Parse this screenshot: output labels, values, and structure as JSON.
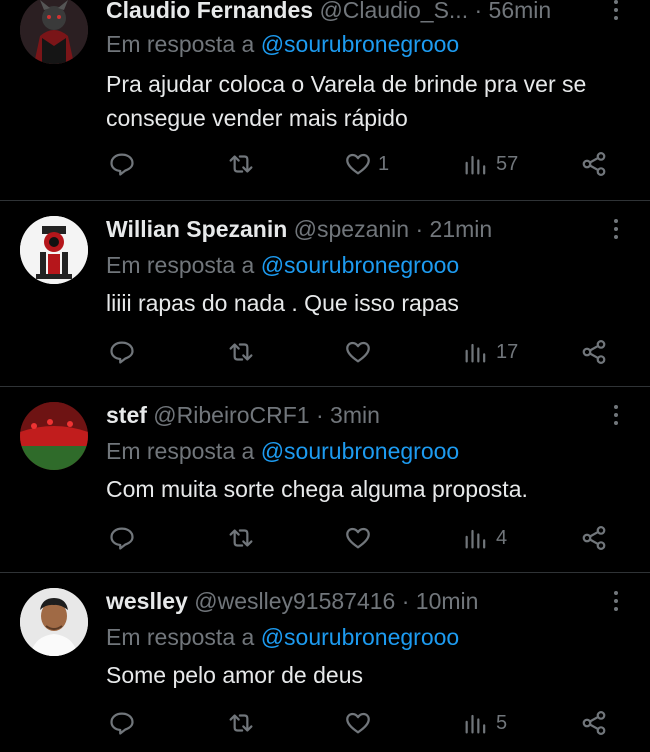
{
  "reply_prefix": "Em resposta a",
  "tweets": [
    {
      "name": "Claudio Fernandes",
      "handle": "@Claudio_S...",
      "separator": "·",
      "time": "56min",
      "mention": "@sourubronegrooo",
      "text": "Pra ajudar coloca o Varela de brinde pra ver se consegue vender mais rápido",
      "likes": "1",
      "views": "57"
    },
    {
      "name": "Willian Spezanin",
      "handle": "@spezanin",
      "separator": "·",
      "time": "21min",
      "mention": "@sourubronegrooo",
      "text": "liiii rapas do nada . Que isso rapas",
      "likes": "",
      "views": "17"
    },
    {
      "name": "stef",
      "handle": "@RibeiroCRF1",
      "separator": "·",
      "time": "3min",
      "mention": "@sourubronegrooo",
      "text": "Com muita sorte chega alguma proposta.",
      "likes": "",
      "views": "4"
    },
    {
      "name": "weslley",
      "handle": "@weslley91587416",
      "separator": "·",
      "time": "10min",
      "mention": "@sourubronegrooo",
      "text": "Some pelo amor de deus",
      "likes": "",
      "views": "5"
    }
  ],
  "colors": {
    "background": "#000000",
    "text": "#e7e9ea",
    "muted": "#71767b",
    "link": "#1d9bf0",
    "divider": "#2f3336"
  }
}
